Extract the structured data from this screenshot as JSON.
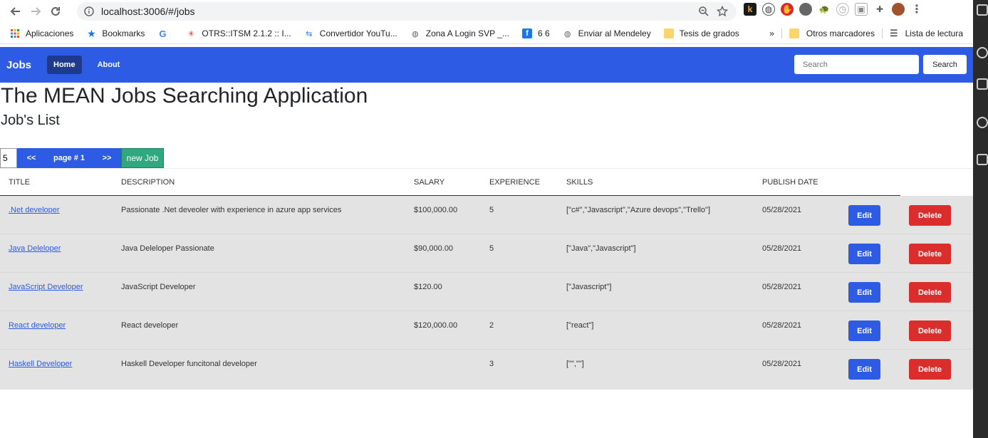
{
  "browser": {
    "url": "localhost:3006/#/jobs",
    "bookmarks": [
      "Aplicaciones",
      "Bookmarks",
      "OTRS::ITSM 2.1.2 :: I...",
      "Convertidor YouTu...",
      "Zona A Login SVP _...",
      "6 6",
      "Enviar al Mendeley",
      "Tesis de grados"
    ],
    "bookmarks_overflow": "»",
    "other_bookmarks": "Otros marcadores",
    "reading_list": "Lista de lectura"
  },
  "navbar": {
    "brand": "Jobs",
    "home": "Home",
    "about": "About",
    "search_placeholder": "Search",
    "search_button": "Search",
    "accent": "#2d5be3"
  },
  "page": {
    "title": "The MEAN Jobs Searching Application",
    "subtitle": "Job's List"
  },
  "pager": {
    "page_size": "5",
    "prev": "<<",
    "label": "page # 1",
    "next": ">>",
    "new_job": "new Job"
  },
  "table": {
    "headers": [
      "TITLE",
      "DESCRIPTION",
      "SALARY",
      "EXPERIENCE",
      "SKILLS",
      "PUBLISH DATE"
    ],
    "edit_label": "Edit",
    "delete_label": "Delete",
    "rows": [
      {
        "title": ".Net developer",
        "description": "Passionate .Net deveoler with experience in azure app services",
        "salary": "$100,000.00",
        "experience": "5",
        "skills": "[\"c#\",\"Javascript\",\"Azure devops\",\"Trello\"]",
        "date": "05/28/2021"
      },
      {
        "title": "Java Deleloper",
        "description": "Java Deleloper Passionate",
        "salary": "$90,000.00",
        "experience": "5",
        "skills": "[\"Java\",\"Javascript\"]",
        "date": "05/28/2021"
      },
      {
        "title": "JavaScript Developer",
        "description": "JavaScript Developer",
        "salary": "$120.00",
        "experience": "",
        "skills": "[\"Javascript\"]",
        "date": "05/28/2021"
      },
      {
        "title": "React developer",
        "description": "React developer",
        "salary": "$120,000.00",
        "experience": "2",
        "skills": "[\"react\"]",
        "date": "05/28/2021"
      },
      {
        "title": "Haskell Developer",
        "description": "Haskell Developer funcitonal developer",
        "salary": "",
        "experience": "3",
        "skills": "[\"\",\"\"]",
        "date": "05/28/2021"
      }
    ]
  }
}
